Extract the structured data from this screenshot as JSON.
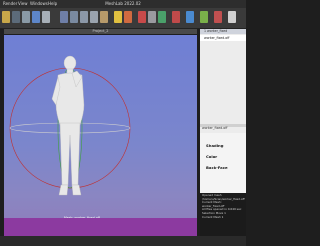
{
  "menu": [
    "Render",
    "View",
    "Windows",
    "Help"
  ],
  "app_title": "MeshLab 2022.02",
  "project_title": "Project_2",
  "toolbar_icons": [
    "open-icon",
    "save-icon",
    "snapshot-icon",
    "info-icon",
    "bbox-icon",
    "points-icon",
    "wireframe-icon",
    "flat-icon",
    "smooth-icon",
    "texture-icon",
    "lighting-icon",
    "colorize-icon",
    "select-icon",
    "measure-icon",
    "align-icon",
    "pick-icon",
    "paint-icon",
    "sculpt-icon",
    "flag-icon",
    "filter-icon"
  ],
  "layer": {
    "header": "1  worker_fixed",
    "row": "worker_fixed.off"
  },
  "properties": {
    "title": "worker_fixed.off",
    "items": [
      "Shading",
      "Color",
      "Back-Face"
    ]
  },
  "mesh_info": [
    "Mesh: worker_fixed.off",
    "Vertices: 1 123 001",
    "Faces: 2 245 983",
    "Selection: v: 0 f: 0"
  ],
  "console_lines": [
    "Opened mesh /home/u/Scan/worker_fixed.off",
    "Current Mesh: worker_fixed.off",
    "All files opened in 0.649 sec",
    "Selection Move 1",
    "Current Mesh 1"
  ],
  "colors": {
    "accent": "#8c3aa0",
    "viewport_top": "#6f7fd4",
    "viewport_bottom": "#8f7cba"
  }
}
